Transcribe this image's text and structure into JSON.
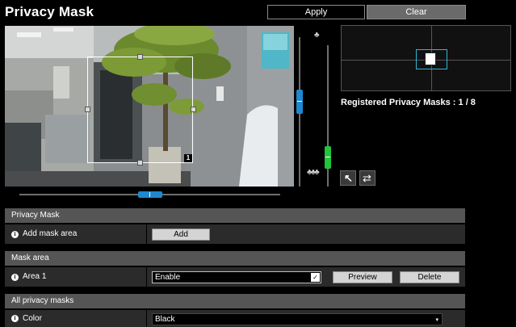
{
  "header": {
    "title": "Privacy Mask",
    "apply_label": "Apply",
    "clear_label": "Clear"
  },
  "camera_view": {
    "mask_number": "1"
  },
  "overview": {
    "registered_text": "Registered Privacy Masks : 1 / 8"
  },
  "sliders": {
    "pan_level": 0.5,
    "tilt_level": 0.42,
    "zoom_level": 0.85
  },
  "sections": {
    "privacy_mask": {
      "header": "Privacy Mask",
      "add_mask_label": "Add mask area",
      "add_button": "Add"
    },
    "mask_area": {
      "header": "Mask area",
      "area_label": "Area 1",
      "area_value": "Enable",
      "preview_button": "Preview",
      "delete_button": "Delete"
    },
    "all_masks": {
      "header": "All privacy masks",
      "color_label": "Color",
      "color_value": "Black"
    }
  },
  "icons": {
    "info": "i",
    "tree_top": "♣",
    "tree_bottom": "♣♣♣",
    "arrow": "↖",
    "swap": "⇄",
    "dropdown": "▾",
    "select_check": "✓"
  },
  "colors": {
    "slider_blue": "#1e88d0",
    "slider_green": "#22c43a",
    "overview_frame": "#2fb7d6"
  }
}
